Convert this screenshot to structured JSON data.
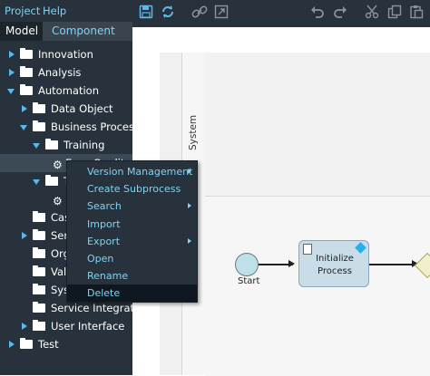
{
  "menubar": {
    "project": "Project",
    "help": "Help"
  },
  "tabs": {
    "model": "Model",
    "component": "Component"
  },
  "tree": [
    {
      "label": "Innovation",
      "level": 0,
      "expanded": false,
      "kind": "folder"
    },
    {
      "label": "Analysis",
      "level": 0,
      "expanded": false,
      "kind": "folder"
    },
    {
      "label": "Automation",
      "level": 0,
      "expanded": true,
      "kind": "folder"
    },
    {
      "label": "Data Object",
      "level": 1,
      "expanded": false,
      "kind": "folder"
    },
    {
      "label": "Business Process",
      "level": 1,
      "expanded": true,
      "kind": "folder"
    },
    {
      "label": "Training",
      "level": 2,
      "expanded": true,
      "kind": "folder"
    },
    {
      "label": "Easy Credit",
      "level": 3,
      "kind": "process",
      "selected": true
    },
    {
      "label": "T",
      "level": 2,
      "expanded": true,
      "kind": "folder"
    },
    {
      "label": "",
      "level": 3,
      "kind": "process"
    },
    {
      "label": "Cas",
      "level": 1,
      "kind": "folder",
      "noarrow": true
    },
    {
      "label": "Servi",
      "level": 1,
      "expanded": false,
      "kind": "folder"
    },
    {
      "label": "Orga",
      "level": 1,
      "kind": "folder",
      "noarrow": true
    },
    {
      "label": "Valu",
      "level": 1,
      "kind": "folder",
      "noarrow": true
    },
    {
      "label": "Syst",
      "level": 1,
      "kind": "folder",
      "noarrow": true
    },
    {
      "label": "Service Integratio",
      "level": 1,
      "kind": "folder",
      "noarrow": true
    },
    {
      "label": "User Interface",
      "level": 1,
      "expanded": false,
      "kind": "folder"
    },
    {
      "label": "Test",
      "level": 0,
      "expanded": false,
      "kind": "folder"
    }
  ],
  "context_menu": [
    {
      "label": "Version Management",
      "submenu": true
    },
    {
      "label": "Create Subprocess",
      "submenu": false
    },
    {
      "label": "Search",
      "submenu": true
    },
    {
      "label": "Import",
      "submenu": false
    },
    {
      "label": "Export",
      "submenu": true
    },
    {
      "label": "Open",
      "submenu": false
    },
    {
      "label": "Rename",
      "submenu": false
    },
    {
      "label": "Delete",
      "submenu": false,
      "active": true
    }
  ],
  "toolbar": {
    "icons": [
      "save-icon",
      "refresh-icon",
      "link-icon",
      "external-link-icon",
      "undo-icon",
      "redo-icon",
      "cut-icon",
      "copy-icon",
      "paste-icon"
    ]
  },
  "diagram": {
    "lane_label": "System",
    "start_label": "Start",
    "task_line1": "Initialize",
    "task_line2": "Process"
  },
  "colors": {
    "panel": "#28323c",
    "accent": "#5bb8e8",
    "link": "#7fd4f2"
  }
}
